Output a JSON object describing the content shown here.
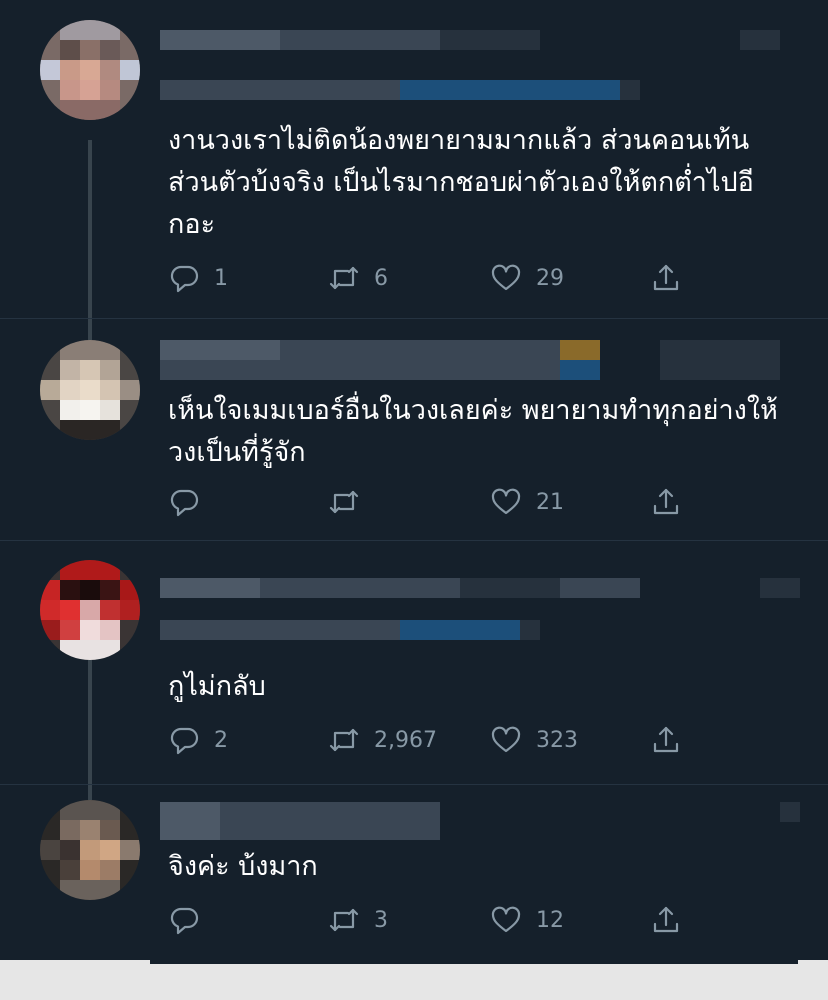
{
  "tweets": [
    {
      "text": "งานวงเราไม่ติดน้องพยายามมากแล้ว ส่วนคอนเท้นส่วนตัวบ้งจริง เป็นไรมากชอบผ่าตัวเองให้ตกต่ำไปอีกอะ",
      "reply_count": "1",
      "retweet_count": "6",
      "like_count": "29"
    },
    {
      "text": "เห็นใจเมมเบอร์อื่นในวงเลยค่ะ พยายามทำทุกอย่างให้วงเป็นที่รู้จัก",
      "reply_count": "",
      "retweet_count": "",
      "like_count": "21"
    },
    {
      "text": "กูไม่กลับ",
      "reply_count": "2",
      "retweet_count": "2,967",
      "like_count": "323"
    },
    {
      "text": "จิงค่ะ บ้งมาก",
      "reply_count": "",
      "retweet_count": "3",
      "like_count": "12"
    }
  ],
  "colors": {
    "background": "#15202b",
    "text": "#ffffff",
    "muted": "#8899a6",
    "thread_line": "#38444d"
  },
  "icons": [
    "reply-icon",
    "retweet-icon",
    "like-icon",
    "share-icon"
  ]
}
